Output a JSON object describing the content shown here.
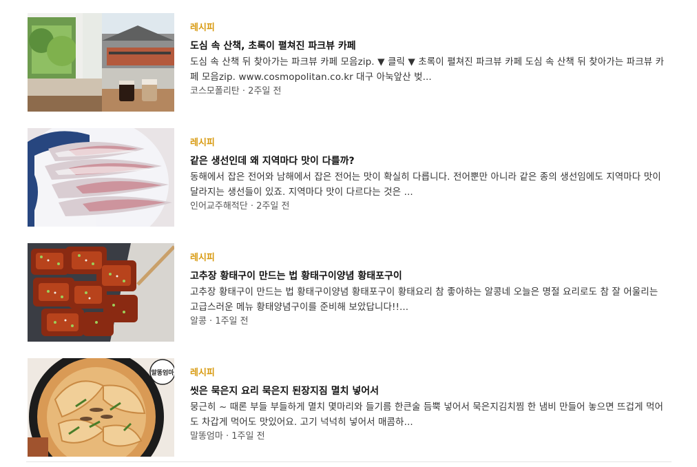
{
  "feed": {
    "items": [
      {
        "category": "레시피",
        "title": "도심 속 산책, 초록이 펼쳐진 파크뷰 카페",
        "description": "도심 속 산책 뒤 찾아가는 파크뷰 카페 모음zip. ▼ 클릭 ▼ 초록이 펼쳐진 파크뷰 카페 도심 속 산책 뒤 찾아가는 파크뷰 카페 모음zip. www.cosmopolitan.co.kr 대구 아눅앞산 벚...",
        "source": "코스모폴리탄",
        "time": "2주일 전",
        "thumbnail": "cafe-terrace-photo"
      },
      {
        "category": "레시피",
        "title": "같은 생선인데 왜 지역마다 맛이 다를까?",
        "description": "동해에서 잡은 전어와 남해에서 잡은 전어는 맛이 확실히 다릅니다. 전어뿐만 아니라 같은 종의 생선임에도 지역마다 맛이 달라지는 생선들이 있죠. 지역마다 맛이 다르다는 것은 ...",
        "source": "인어교주해적단",
        "time": "2주일 전",
        "thumbnail": "sliced-raw-fish-photo"
      },
      {
        "category": "레시피",
        "title": "고추장 황태구이 만드는 법 황태구이양념 황태포구이",
        "description": "고추장 황태구이 만드는 법 황태구이양념 황태포구이 황태요리 참 좋아하는 알콩네 오늘은 명절 요리로도 참 잘 어울리는 고급스러운 메뉴 황태양념구이를 준비해 보았답니다!!...",
        "source": "알콩",
        "time": "1주일 전",
        "thumbnail": "grilled-pollock-photo"
      },
      {
        "category": "레시피",
        "title": "씻은 묵은지 요리 묵은지 된장지짐 멸치 넣어서",
        "description": "뭉근히 ~ 때론 부들 부들하게 멸치 몇마리와 들기름 한큰술 듬뿍 넣어서 묵은지김치찜 한 냄비 만들어 놓으면 뜨겁게 먹어도 차갑게 먹어도 맛있어요. 고기 넉넉히 넣어서 매콤하...",
        "source": "말똥엄마",
        "time": "1주일 전",
        "thumbnail": "braised-kimchi-photo",
        "watermark": "말똥엄마"
      }
    ],
    "meta_separator": " · "
  }
}
